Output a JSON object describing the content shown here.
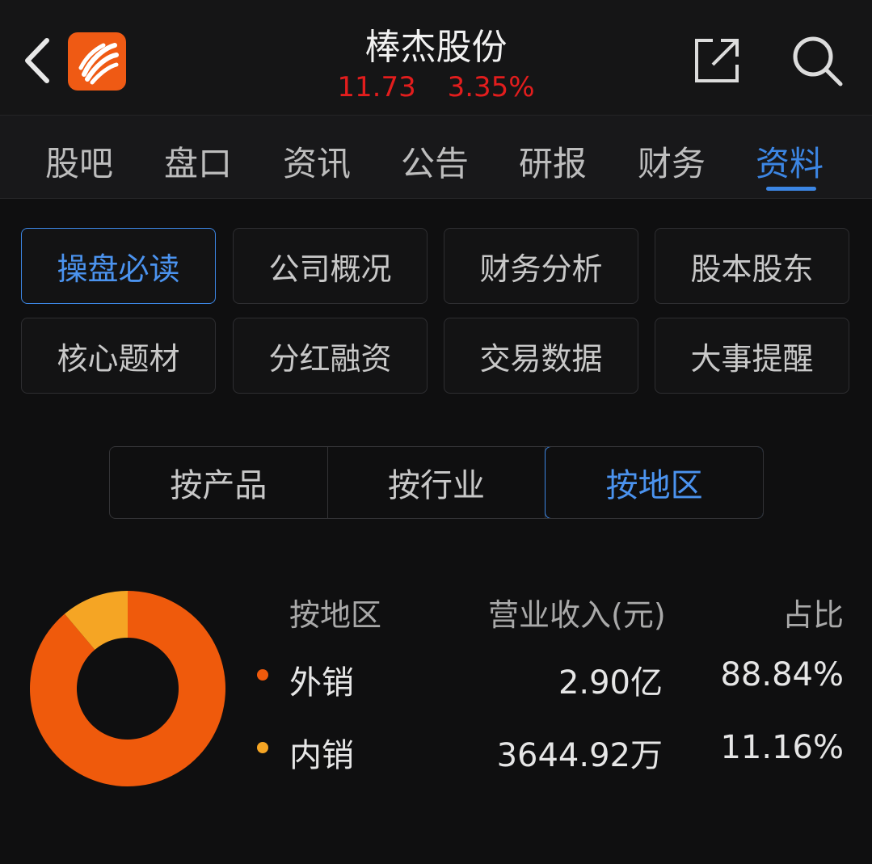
{
  "header": {
    "stock_name": "棒杰股份",
    "price": "11.73",
    "change_pct": "3.35%"
  },
  "tabs": [
    {
      "label": "股吧"
    },
    {
      "label": "盘口"
    },
    {
      "label": "资讯"
    },
    {
      "label": "公告"
    },
    {
      "label": "研报"
    },
    {
      "label": "财务"
    },
    {
      "label": "资料",
      "active": true
    }
  ],
  "sections": [
    {
      "label": "操盘必读",
      "active": true
    },
    {
      "label": "公司概况"
    },
    {
      "label": "财务分析"
    },
    {
      "label": "股本股东"
    },
    {
      "label": "核心题材"
    },
    {
      "label": "分红融资"
    },
    {
      "label": "交易数据"
    },
    {
      "label": "大事提醒"
    }
  ],
  "segment": [
    {
      "label": "按产品"
    },
    {
      "label": "按行业"
    },
    {
      "label": "按地区",
      "active": true
    }
  ],
  "table": {
    "headers": [
      "按地区",
      "营业收入(元)",
      "占比"
    ],
    "rows": [
      {
        "name": "外销",
        "revenue": "2.90亿",
        "pct": "88.84%",
        "color": "#ef5a0c"
      },
      {
        "name": "内销",
        "revenue": "3644.92万",
        "pct": "11.16%",
        "color": "#f5a524"
      }
    ]
  },
  "chart_data": {
    "type": "pie",
    "categories": [
      "外销",
      "内销"
    ],
    "values": [
      88.84,
      11.16
    ],
    "colors": [
      "#ef5a0c",
      "#f5a524"
    ]
  },
  "colors": {
    "accent": "#3c86e4",
    "price_up": "#e21d1d",
    "background": "#0f0f10"
  }
}
